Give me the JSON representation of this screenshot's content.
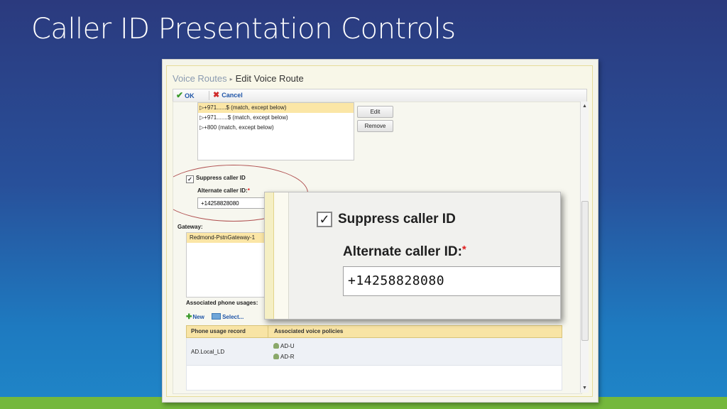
{
  "slide": {
    "title": "Caller ID Presentation Controls"
  },
  "breadcrumb": {
    "parent": "Voice Routes",
    "separator": "▸",
    "current": "Edit Voice Route"
  },
  "toolbar": {
    "ok_label": "OK",
    "cancel_label": "Cancel"
  },
  "patterns": {
    "items": [
      {
        "label": "+971......$ (match, except below)",
        "selected": true
      },
      {
        "label": "+971.......$ (match, except below)",
        "selected": false
      },
      {
        "label": "+800 (match, except below)",
        "selected": false
      }
    ],
    "edit_label": "Edit",
    "remove_label": "Remove"
  },
  "caller_id": {
    "suppress_label": "Suppress caller ID",
    "suppress_checked": true,
    "check_glyph": "✓",
    "alternate_label": "Alternate caller ID:",
    "required_mark": "*",
    "alternate_value": "+14258828080"
  },
  "gateway": {
    "label": "Gateway:",
    "items": [
      "Redmond-PstnGateway-1"
    ]
  },
  "usages": {
    "label": "Associated phone usages:",
    "new_label": "New",
    "select_label": "Select...",
    "columns": [
      "Phone usage record",
      "Associated voice policies"
    ],
    "rows": [
      {
        "record": "AD.Local_LD",
        "policies": [
          "AD-U",
          "AD-R"
        ]
      }
    ]
  },
  "icons": {
    "ok": "checkmark-icon",
    "cancel": "x-icon",
    "new": "plus-icon",
    "select": "select-icon",
    "policy": "users-icon",
    "pattern": "triangle-icon"
  },
  "colors": {
    "slide_bg_top": "#2b3a7e",
    "slide_bg_bottom": "#1f86c8",
    "accent_green": "#74b83c",
    "selection": "#fbe6a6",
    "annotation_ellipse": "#b05050"
  }
}
